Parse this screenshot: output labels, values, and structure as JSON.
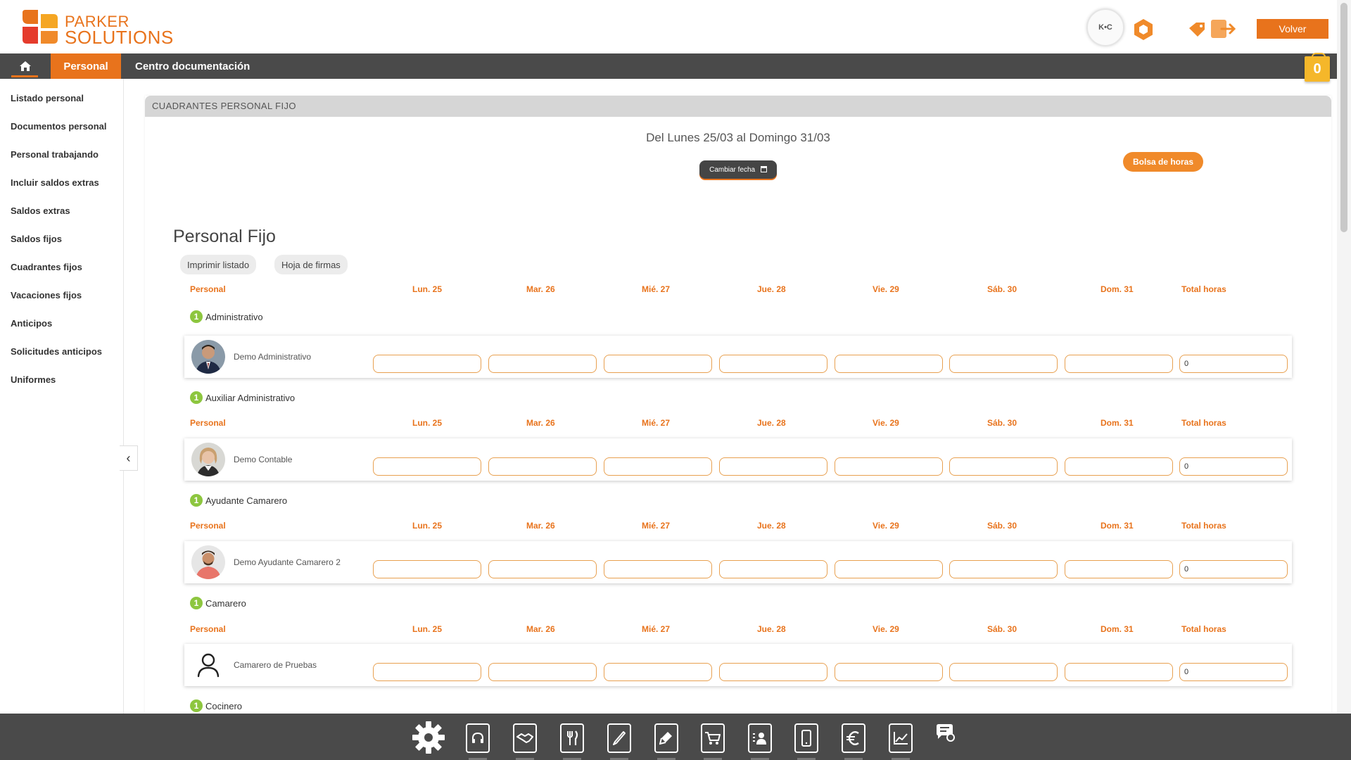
{
  "brand": {
    "line1": "PARKER",
    "line2": "SOLUTIONS"
  },
  "header": {
    "avatar_text": "K•C",
    "volver_label": "Volver"
  },
  "nav": {
    "personal": "Personal",
    "centro": "Centro documentación",
    "cart_count": "0"
  },
  "sidebar": {
    "items": [
      "Listado personal",
      "Documentos personal",
      "Personal trabajando",
      "Incluir saldos extras",
      "Saldos extras",
      "Saldos fijos",
      "Cuadrantes fijos",
      "Vacaciones fijos",
      "Anticipos",
      "Solicitudes anticipos",
      "Uniformes"
    ]
  },
  "panel": {
    "title": "CUADRANTES PERSONAL FIJO",
    "date_range": "Del Lunes 25/03 al Domingo 31/03",
    "cambiar_label": "Cambiar fecha",
    "bolsa_label": "Bolsa de horas",
    "section_title": "Personal Fijo",
    "imprimir_label": "Imprimir listado",
    "hoja_label": "Hoja de firmas"
  },
  "columns": [
    "Personal",
    "Lun. 25",
    "Mar. 26",
    "Mié. 27",
    "Jue. 28",
    "Vie. 29",
    "Sáb. 30",
    "Dom. 31",
    "Total horas"
  ],
  "groups": [
    {
      "count": "1",
      "name": "Administrativo",
      "employee": "Demo Administrativo",
      "total": "0",
      "photo": "man-suit"
    },
    {
      "count": "1",
      "name": "Auxiliar Administrativo",
      "employee": "Demo Contable",
      "total": "0",
      "photo": "woman"
    },
    {
      "count": "1",
      "name": "Ayudante Camarero",
      "employee": "Demo Ayudante Camarero 2",
      "total": "0",
      "photo": "man-casual"
    },
    {
      "count": "1",
      "name": "Camarero",
      "employee": "Camarero de Pruebas",
      "total": "0",
      "photo": "placeholder"
    },
    {
      "count": "1",
      "name": "Cocinero"
    }
  ],
  "colors": {
    "accent": "#e8731c",
    "dark": "#4a4a4a",
    "badge_green": "#8dc63f",
    "cart": "#f5b72a"
  },
  "toolbar": {
    "icons": [
      "gear-icon",
      "headset-icon",
      "handshake-icon",
      "cutlery-icon",
      "pen-icon",
      "marker-icon",
      "cart-icon",
      "contacts-icon",
      "mobile-icon",
      "euro-icon",
      "chart-icon",
      "chat-icon"
    ]
  }
}
